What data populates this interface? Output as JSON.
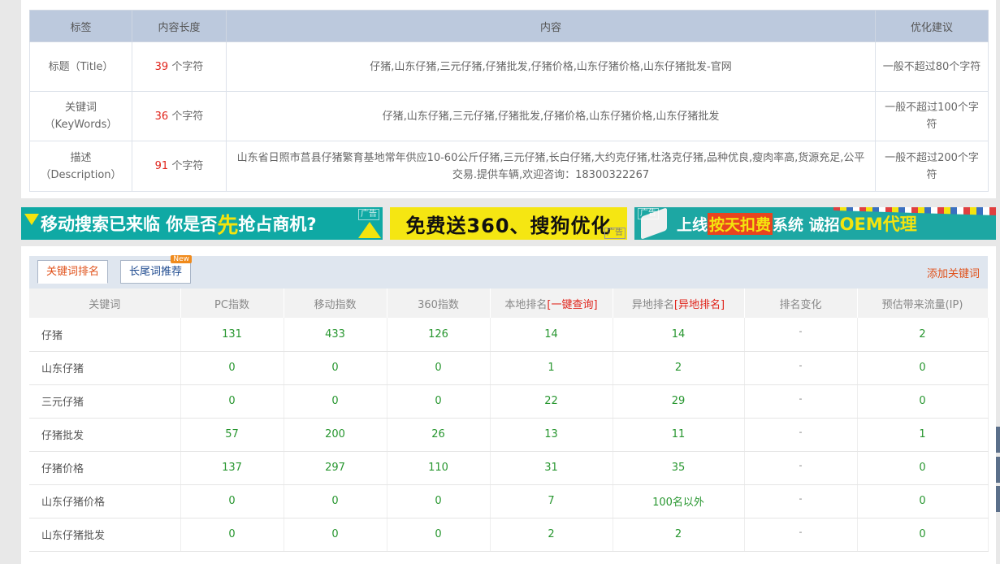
{
  "meta": {
    "headers": [
      "标签",
      "内容长度",
      "内容",
      "优化建议"
    ],
    "unit": "个字符",
    "rows": [
      {
        "label": "标题（Title）",
        "label2": "",
        "length": "39",
        "content": "仔猪,山东仔猪,三元仔猪,仔猪批发,仔猪价格,山东仔猪价格,山东仔猪批发-官网",
        "advice": "一般不超过80个字符"
      },
      {
        "label": "关键词",
        "label2": "（KeyWords）",
        "length": "36",
        "content": "仔猪,山东仔猪,三元仔猪,仔猪批发,仔猪价格,山东仔猪价格,山东仔猪批发",
        "advice": "一般不超过100个字符"
      },
      {
        "label": "描述",
        "label2": "（Description）",
        "length": "91",
        "content": "山东省日照市莒县仔猪繁育基地常年供应10-60公斤仔猪,三元仔猪,长白仔猪,大约克仔猪,杜洛克仔猪,品种优良,瘦肉率高,货源充足,公平交易.提供车辆,欢迎咨询：18300322267",
        "advice": "一般不超过200个字符"
      }
    ]
  },
  "ads": {
    "ad1": {
      "part1": "移动搜索已来临 你是否",
      "highlight": "先",
      "part2": "抢占商机?",
      "tag": "广告"
    },
    "ad2": {
      "text": "免费送360、搜狗优化",
      "tag": "广告"
    },
    "ad3": {
      "part1": "上线 ",
      "highlight": "按天扣费",
      "part2": " 系统 诚招 ",
      "oem": "OEM代理",
      "tag": "广告"
    }
  },
  "keywords": {
    "tabs": [
      {
        "label": "关键词排名"
      },
      {
        "label": "长尾词推荐",
        "badge": "New"
      }
    ],
    "add_link": "添加关键词",
    "headers": {
      "keyword": "关键词",
      "pc": "PC指数",
      "mobile": "移动指数",
      "s360": "360指数",
      "local": "本地排名",
      "local_link": "[一键查询]",
      "remote": "异地排名",
      "remote_link": "[异地排名]",
      "change": "排名变化",
      "traffic": "预估带来流量(IP)"
    },
    "rows": [
      {
        "keyword": "仔猪",
        "pc": "131",
        "mobile": "433",
        "s360": "126",
        "local": "14",
        "remote": "14",
        "change": "-",
        "traffic": "2"
      },
      {
        "keyword": "山东仔猪",
        "pc": "0",
        "mobile": "0",
        "s360": "0",
        "local": "1",
        "remote": "2",
        "change": "-",
        "traffic": "0"
      },
      {
        "keyword": "三元仔猪",
        "pc": "0",
        "mobile": "0",
        "s360": "0",
        "local": "22",
        "remote": "29",
        "change": "-",
        "traffic": "0"
      },
      {
        "keyword": "仔猪批发",
        "pc": "57",
        "mobile": "200",
        "s360": "26",
        "local": "13",
        "remote": "11",
        "change": "-",
        "traffic": "1"
      },
      {
        "keyword": "仔猪价格",
        "pc": "137",
        "mobile": "297",
        "s360": "110",
        "local": "31",
        "remote": "35",
        "change": "-",
        "traffic": "0"
      },
      {
        "keyword": "山东仔猪价格",
        "pc": "0",
        "mobile": "0",
        "s360": "0",
        "local": "7",
        "remote": "100名以外",
        "change": "-",
        "traffic": "0"
      },
      {
        "keyword": "山东仔猪批发",
        "pc": "0",
        "mobile": "0",
        "s360": "0",
        "local": "2",
        "remote": "2",
        "change": "-",
        "traffic": "0"
      }
    ]
  },
  "colors": {
    "accent_red": "#e0241b",
    "accent_orange": "#e0511a",
    "value_green": "#27962f",
    "header_blue": "#bcc9dd"
  }
}
